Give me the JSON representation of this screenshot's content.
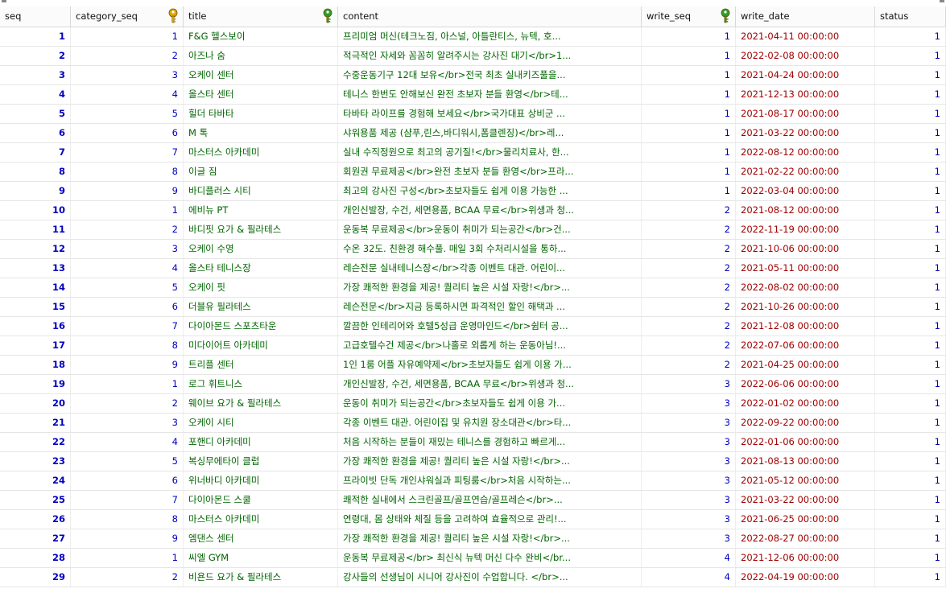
{
  "columns": [
    {
      "label": "seq",
      "key": false
    },
    {
      "label": "category_seq",
      "key": true
    },
    {
      "label": "title",
      "key": true
    },
    {
      "label": "content",
      "key": false
    },
    {
      "label": "write_seq",
      "key": true
    },
    {
      "label": "write_date",
      "key": false
    },
    {
      "label": "status",
      "key": false
    }
  ],
  "colors": {
    "id": "#0000c0",
    "text": "#006400",
    "date": "#a00000",
    "key_icon": "#e0a800",
    "key_icon_green": "#2e9e2e"
  },
  "rows": [
    [
      "1",
      "1",
      "F&G 헬스보이",
      "프리미엄 머신(테크노짐, 아스널, 아틀란티스, 뉴텍, 호...",
      "1",
      "2021-04-11 00:00:00",
      "1"
    ],
    [
      "2",
      "2",
      "아즈나 숨",
      "적극적인 자세와 꼼꼼히 알려주시는 강사진 대기</br>1...",
      "1",
      "2022-02-08 00:00:00",
      "1"
    ],
    [
      "3",
      "3",
      "오케이 센터",
      "수중운동기구 12대 보유</br>전국 최초 실내키즈풀을...",
      "1",
      "2021-04-24 00:00:00",
      "1"
    ],
    [
      "4",
      "4",
      "올스타 센터",
      "테니스 한번도 안해보신 완전 초보자 분들 환영</br>테...",
      "1",
      "2021-12-13 00:00:00",
      "1"
    ],
    [
      "5",
      "5",
      "힐더 타바타",
      "타바타 라이프를 경험해 보세요</br>국가대표 상비군 ...",
      "1",
      "2021-08-17 00:00:00",
      "1"
    ],
    [
      "6",
      "6",
      "M 톡",
      "샤워용품 제공 (샴푸,린스,바디워시,폼클렌징)</br>레...",
      "1",
      "2021-03-22 00:00:00",
      "1"
    ],
    [
      "7",
      "7",
      "마스터스 아카데미",
      "실내 수직정원으로 최고의 공기질!</br>물리치료사, 한...",
      "1",
      "2022-08-12 00:00:00",
      "1"
    ],
    [
      "8",
      "8",
      "이글 짐",
      "회원권 무료제공</br>완전 초보자 분들 환영</br>프라...",
      "1",
      "2021-02-22 00:00:00",
      "1"
    ],
    [
      "9",
      "9",
      "바디플러스 시티",
      "최고의 강사진 구성</br>초보자들도 쉽게 이용 가능한 ...",
      "1",
      "2022-03-04 00:00:00",
      "1"
    ],
    [
      "10",
      "1",
      "에비뉴 PT",
      "개인신발장, 수건, 세면용품, BCAA 무료</br>위생과 청...",
      "2",
      "2021-08-12 00:00:00",
      "1"
    ],
    [
      "11",
      "2",
      "바디핏 요가 & 필라테스",
      "운동복 무료제공</br>운동이 취미가 되는공간</br>건...",
      "2",
      "2022-11-19 00:00:00",
      "1"
    ],
    [
      "12",
      "3",
      "오케이 수영",
      "수온 32도. 친환경 해수풀. 매일 3회 수처리시설을 통하...",
      "2",
      "2021-10-06 00:00:00",
      "1"
    ],
    [
      "13",
      "4",
      "올스타 테니스장",
      "레슨전문 실내테니스장</br>각종 이벤트 대관. 어린이...",
      "2",
      "2021-05-11 00:00:00",
      "1"
    ],
    [
      "14",
      "5",
      "오케이 핏",
      "가장 쾌적한 환경을 제공! 퀄리티 높은 시설 자랑!</br>...",
      "2",
      "2022-08-02 00:00:00",
      "1"
    ],
    [
      "15",
      "6",
      "더블유 필라테스",
      "레슨전문</br>지금 등록하시면 파격적인 할인 해택과 ...",
      "2",
      "2021-10-26 00:00:00",
      "1"
    ],
    [
      "16",
      "7",
      "다이아몬드 스포츠타운",
      "깔끔한 인테리어와 호텔5성급 운영마인드</br>쉼터 공...",
      "2",
      "2021-12-08 00:00:00",
      "1"
    ],
    [
      "17",
      "8",
      "미다이어트 아카데미",
      "고급호텔수건 제공</br>나홀로 외롭게 하는 운동아님!...",
      "2",
      "2022-07-06 00:00:00",
      "1"
    ],
    [
      "18",
      "9",
      "트리플 센터",
      "1인 1룸 어플 자유예약제</br>초보자들도 쉽게 이용 가...",
      "2",
      "2021-04-25 00:00:00",
      "1"
    ],
    [
      "19",
      "1",
      "로그 휘트니스",
      "개인신발장, 수건, 세면용품, BCAA 무료</br>위생과 청...",
      "3",
      "2022-06-06 00:00:00",
      "1"
    ],
    [
      "20",
      "2",
      "웨이브 요가 & 필라테스",
      "운동이 취미가 되는공간</br>초보자들도 쉽게 이용 가...",
      "3",
      "2022-01-02 00:00:00",
      "1"
    ],
    [
      "21",
      "3",
      "오케이 시티",
      "각종 이벤트 대관. 어린이집 및 유치원 장소대관</br>타...",
      "3",
      "2022-09-22 00:00:00",
      "1"
    ],
    [
      "22",
      "4",
      "포핸디 아카데미",
      "처음 시작하는 분들이 재밌는 테니스를 경험하고 빠르게...",
      "3",
      "2022-01-06 00:00:00",
      "1"
    ],
    [
      "23",
      "5",
      "복싱무에타이 클럽",
      "가장 쾌적한 환경을 제공! 퀄리티 높은 시설 자랑!</br>...",
      "3",
      "2021-08-13 00:00:00",
      "1"
    ],
    [
      "24",
      "6",
      "위너바디 아카데미",
      "프라이빗 단독 개인샤워실과 피팅룸</br>처음 시작하는...",
      "3",
      "2021-05-12 00:00:00",
      "1"
    ],
    [
      "25",
      "7",
      "다이아몬드 스쿨",
      "쾌적한 실내에서 스크린골프/골프연습/골프레슨</br>...",
      "3",
      "2021-03-22 00:00:00",
      "1"
    ],
    [
      "26",
      "8",
      "마스터스 아카데미",
      "연령대, 몸 상태와 체질 등을 고려하여 효율적으로 관리!...",
      "3",
      "2021-06-25 00:00:00",
      "1"
    ],
    [
      "27",
      "9",
      "엠댄스 센터",
      "가장 쾌적한 환경을 제공! 퀄리티 높은 시설 자랑!</br>...",
      "3",
      "2022-08-27 00:00:00",
      "1"
    ],
    [
      "28",
      "1",
      "씨엘 GYM",
      "운동복 무료제공</br> 최신식 뉴텍 머신 다수 완비</br...",
      "4",
      "2021-12-06 00:00:00",
      "1"
    ],
    [
      "29",
      "2",
      "비욘드 요가 & 필라테스",
      "강사들의 선생님이 시니어 강사진이 수업합니다. </br>...",
      "4",
      "2022-04-19 00:00:00",
      "1"
    ]
  ]
}
